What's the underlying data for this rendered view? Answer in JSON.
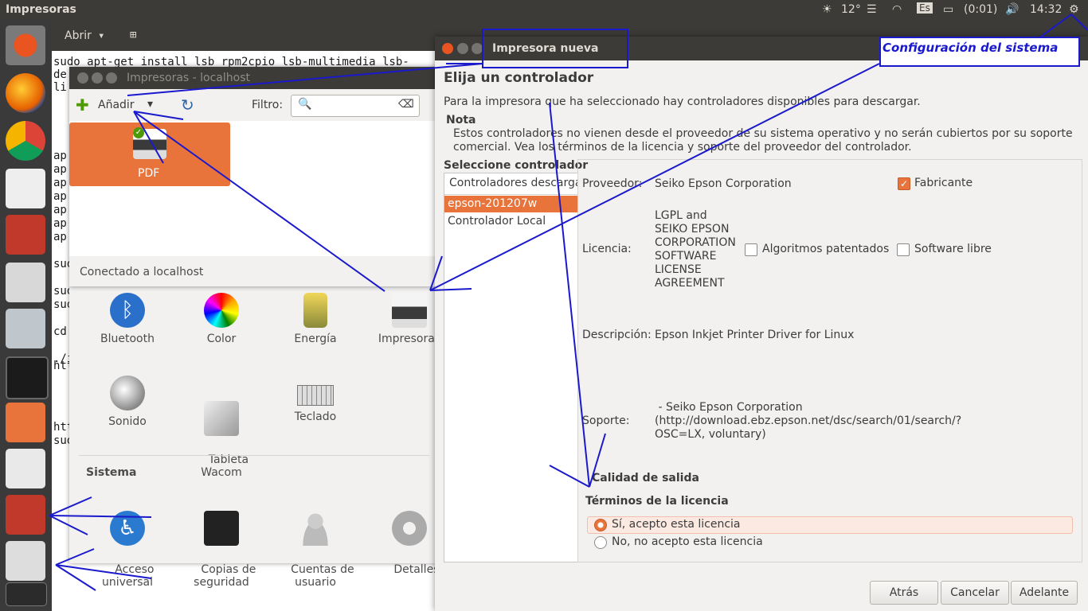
{
  "top_panel": {
    "app_title": "Impresoras",
    "weather": "12°",
    "keyboard": "Es",
    "battery": "(0:01)",
    "time": "14:32"
  },
  "terminal": {
    "open_label": "Abrir",
    "lines": [
      "sudo apt-get install lsb rpm2cpio lsb-multimedia lsb-",
      "de",
      "li",
      "ap",
      "ap",
      "ap",
      "ap",
      "ap",
      "ap",
      "ap",
      "sud",
      "sud",
      "sud",
      "cd",
      "./i",
      "htt",
      "htt",
      "sud"
    ]
  },
  "printers_window": {
    "title": "Impresoras - localhost",
    "add_label": "Añadir",
    "filter_label": "Filtro:",
    "filter_value": "",
    "printer_name": "PDF",
    "status": "Conectado a localhost"
  },
  "settings_window": {
    "hardware_items": [
      "Bluetooth",
      "Color",
      "Energía",
      "Impresoras",
      "Sonido",
      "Tableta\nWacom",
      "Teclado"
    ],
    "system_section": "Sistema",
    "system_items": [
      "Acceso\nuniversal",
      "Copias de\nseguridad",
      "Cuentas de\nusuario",
      "Detalles"
    ]
  },
  "dialog": {
    "title": "Impresora nueva",
    "heading": "Elija un controlador",
    "intro": "Para la impresora que ha seleccionado hay controladores disponibles para descargar.",
    "note_title": "Nota",
    "note_text": "Estos controladores no vienen desde el proveedor de su sistema operativo y no serán cubiertos por su soporte\ncomercial. Vea los términos de la licencia y soporte del proveedor del controlador.",
    "select_label": "Seleccione controlador",
    "list_header": "Controladores descarga",
    "list_items": [
      "epson-201207w",
      "Controlador Local"
    ],
    "provider_label": "Proveedor:",
    "provider_value": "Seiko Epson Corporation",
    "manufacturer_label": "Fabricante",
    "license_label": "Licencia:",
    "license_value": "LGPL and\nSEIKO EPSON\nCORPORATION\nSOFTWARE\nLICENSE\nAGREEMENT",
    "patented_label": "Algoritmos patentados",
    "free_label": "Software libre",
    "description_label": "Descripción:",
    "description_value": "Epson Inkjet Printer Driver for Linux",
    "support_label": "Soporte:",
    "support_value": " - Seiko Epson Corporation\n(http://download.ebz.epson.net/dsc/search/01/search/?\nOSC=LX, voluntary)",
    "quality_label": "Calidad de salida",
    "terms_label": "Términos de la licencia",
    "accept_label": "Sí, acepto esta licencia",
    "reject_label": "No, no acepto esta licencia",
    "back_label": "Atrás",
    "cancel_label": "Cancelar",
    "forward_label": "Adelante"
  },
  "annotation": {
    "label": "Configuración del sistema",
    "color": "#1a1acc"
  },
  "colors": {
    "panel": "#3c3b37",
    "accent": "#e8743c",
    "launcher": "#3a3a3a"
  }
}
